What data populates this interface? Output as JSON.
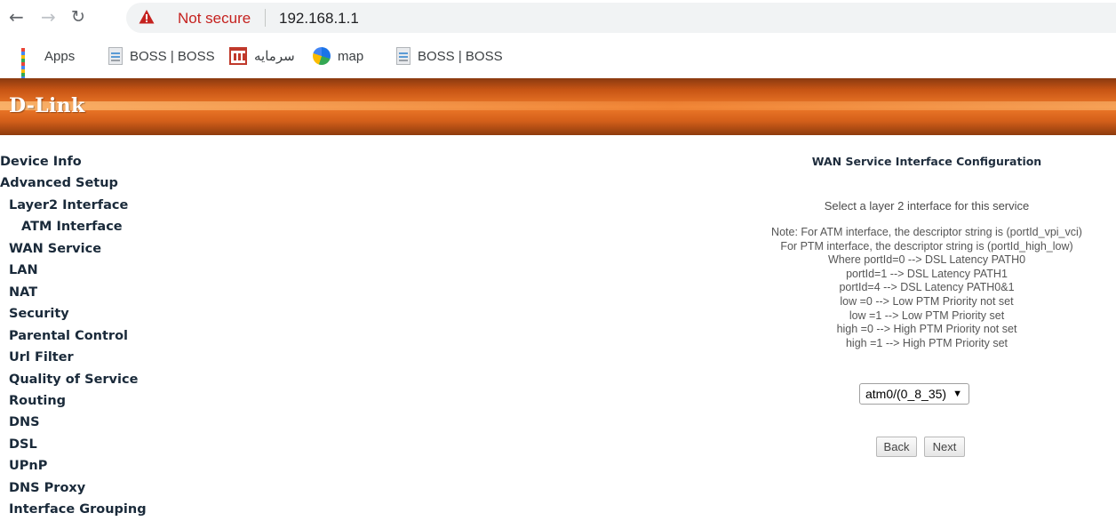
{
  "browser": {
    "security_label": "Not secure",
    "url": "192.168.1.1",
    "nav": {
      "back_icon": "arrow-left-icon",
      "forward_icon": "arrow-right-icon",
      "reload_icon": "reload-icon"
    }
  },
  "bookmarks": [
    {
      "label": "Apps",
      "icon": "apps-grid-icon"
    },
    {
      "label": "BOSS | BOSS",
      "icon": "page-icon"
    },
    {
      "label": "سرمایه",
      "icon": "store-icon"
    },
    {
      "label": "map",
      "icon": "map-icon"
    },
    {
      "label": "BOSS | BOSS",
      "icon": "page-icon"
    }
  ],
  "header": {
    "logo": "D-Link",
    "accent": "#e8701f"
  },
  "sidebar": {
    "items": [
      {
        "label": "Device Info"
      },
      {
        "label": "Advanced Setup"
      },
      {
        "label": "Layer2 Interface"
      },
      {
        "label": "ATM Interface"
      },
      {
        "label": "WAN Service"
      },
      {
        "label": "LAN"
      },
      {
        "label": "NAT"
      },
      {
        "label": "Security"
      },
      {
        "label": "Parental Control"
      },
      {
        "label": "Url Filter"
      },
      {
        "label": "Quality of Service"
      },
      {
        "label": "Routing"
      },
      {
        "label": "DNS"
      },
      {
        "label": "DSL"
      },
      {
        "label": "UPnP"
      },
      {
        "label": "DNS Proxy"
      },
      {
        "label": "Interface Grouping"
      }
    ]
  },
  "main": {
    "title": "WAN Service Interface Configuration",
    "select_hint": "Select a layer 2 interface for this service",
    "note_lines": [
      "Note: For ATM interface, the descriptor string is (portId_vpi_vci)",
      "For PTM interface, the descriptor string is (portId_high_low)",
      "Where portId=0 --> DSL Latency PATH0",
      "portId=1 --> DSL Latency PATH1",
      "portId=4 --> DSL Latency PATH0&1",
      "low =0 --> Low PTM Priority not set",
      "low =1 --> Low PTM Priority set",
      "high =0 --> High PTM Priority not set",
      "high =1 --> High PTM Priority set"
    ],
    "interface_select": {
      "value": "atm0/(0_8_35)"
    },
    "back_label": "Back",
    "next_label": "Next"
  }
}
